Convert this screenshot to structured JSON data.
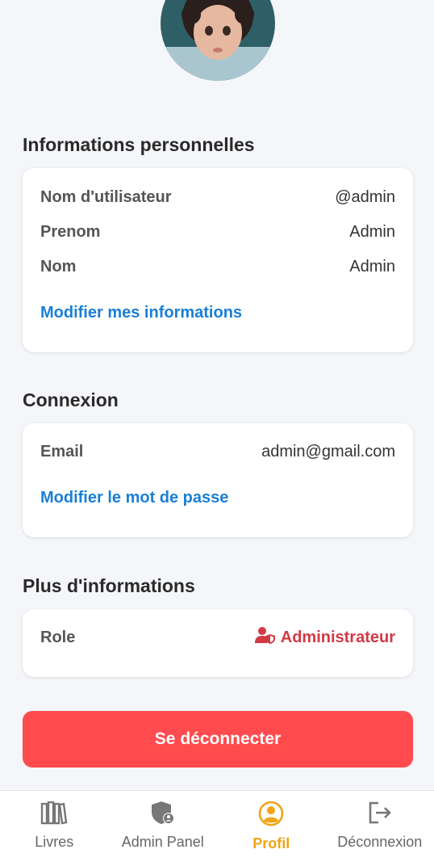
{
  "sections": {
    "personal": {
      "title": "Informations personnelles",
      "rows": [
        {
          "label": "Nom d'utilisateur",
          "value": "@admin"
        },
        {
          "label": "Prenom",
          "value": "Admin"
        },
        {
          "label": "Nom",
          "value": "Admin"
        }
      ],
      "edit_link": "Modifier mes informations"
    },
    "connexion": {
      "title": "Connexion",
      "rows": [
        {
          "label": "Email",
          "value": "admin@gmail.com"
        }
      ],
      "edit_link": "Modifier le mot de passe"
    },
    "more": {
      "title": "Plus d'informations",
      "role_label": "Role",
      "role_value": "Administrateur",
      "role_icon": "user-shield-icon",
      "role_color": "#d23a44"
    }
  },
  "logout_button": "Se déconnecter",
  "nav": {
    "items": [
      {
        "label": "Livres",
        "icon": "books-icon",
        "active": false
      },
      {
        "label": "Admin Panel",
        "icon": "shield-user-icon",
        "active": false
      },
      {
        "label": "Profil",
        "icon": "profile-icon",
        "active": true
      },
      {
        "label": "Déconnexion",
        "icon": "logout-icon",
        "active": false
      }
    ],
    "active_color": "#f0a417"
  },
  "colors": {
    "link": "#1a7fd6",
    "logout_bg": "#ff4b4e",
    "background": "#f4f6f9"
  }
}
